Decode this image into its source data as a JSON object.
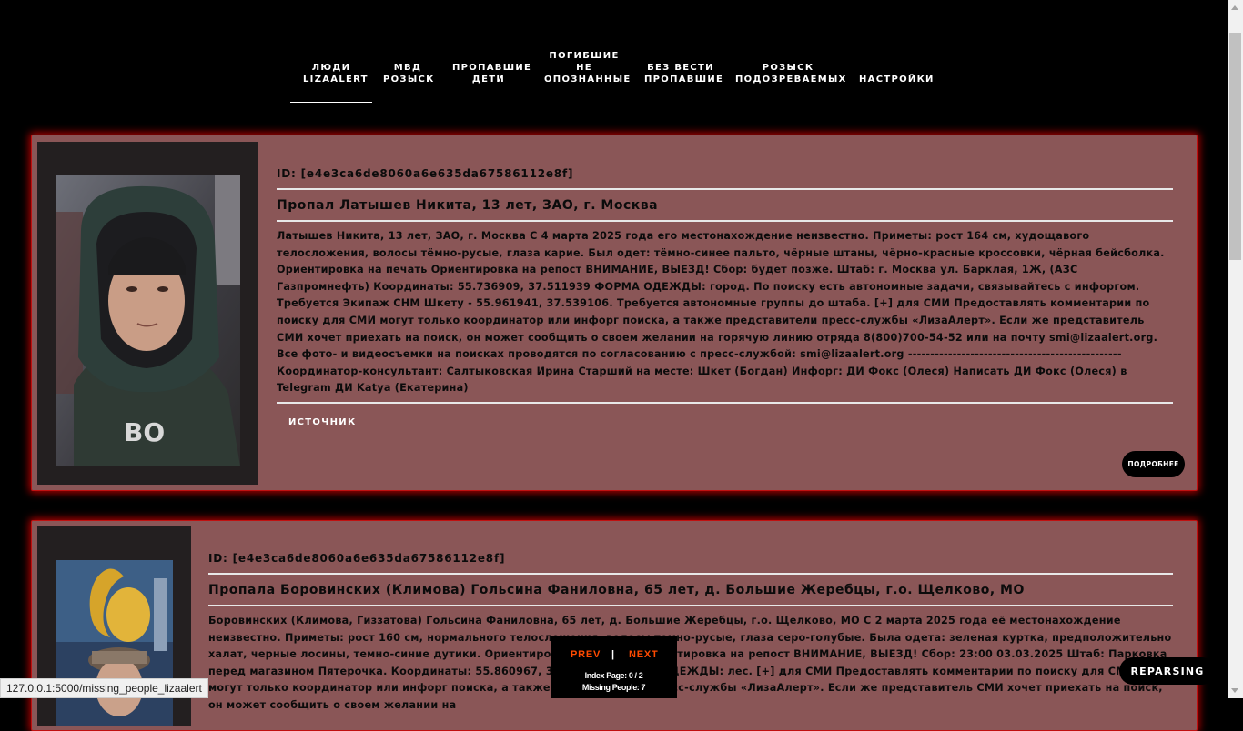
{
  "nav": {
    "items": [
      {
        "label": "ЛЮДИ\nLIZAALERT",
        "active": true
      },
      {
        "label": "МВД\nРОЗЫСК"
      },
      {
        "label": "ПРОПАВШИЕ\nДЕТИ"
      },
      {
        "label": "ПОГИБШИЕ\nНЕ\nОПОЗНАННЫЕ"
      },
      {
        "label": "БЕЗ ВЕСТИ\nПРОПАВШИЕ"
      },
      {
        "label": "РОЗЫСК\nПОДОЗРЕВАЕМЫХ"
      },
      {
        "label": "НАСТРОЙКИ"
      }
    ]
  },
  "cards": [
    {
      "id": "ID: [e4e3ca6de8060a6e635da67586112e8f]",
      "title": "Пропал Латышев Никита, 13 лет, ЗАО, г. Москва",
      "text": "Латышев Никита, 13 лет, ЗАО, г. Москва С 4 марта 2025 года его местонахождение неизвестно. Приметы: рост 164 см, худощавого телосложения, волосы тёмно-русые, глаза карие. Был одет: тёмно-синее пальто, чёрные штаны, чёрно-красные кроссовки, чёрная бейсболка. Ориентировка на печать Ориентировка на репост ВНИМАНИЕ, ВЫЕЗД! Сбор: будет позже. Штаб: г. Москва ул. Барклая, 1Ж, (АЗС Газпромнефть) Координаты: 55.736909, 37.511939 ФОРМА ОДЕЖДЫ: город. По поиску есть автономные задачи, связывайтесь с инфоргом. Требуется Экипаж СНМ Шкету - 55.961941, 37.539106. Требуется автономные группы до штаба. [+] для СМИ Предоставлять комментарии по поиску для СМИ могут только координатор или инфорг поиска, а также представители пресс-службы «ЛизаАлерт». Если же представитель СМИ хочет приехать на поиск, он может сообщить о своем желании на горячую линию отряда 8(800)700-54-52 или на почту smi@lizaalert.org. Все фото- и видеосъемки на поисках проводятся по согласованию с пресс-службой: smi@lizaalert.org ------------------------------------------------ Координатор-консультант: Салтыковская Ирина Старший на месте: Шкет (Богдан) Инфорг: ДИ Фокс (Олеся) Написать ДИ Фокс (Олеся) в Telegram ДИ Katya (Екатерина)",
      "source_label": "ИСТОЧНИК",
      "more_label": "ПОДРОБНЕЕ"
    },
    {
      "id": "ID: [e4e3ca6de8060a6e635da67586112e8f]",
      "title": "Пропала Боровинских (Климова) Гольсина Фаниловна, 65 лет, д. Большие Жеребцы, г.о. Щелково, МО",
      "text": "Боровинских (Климова, Гиззатова) Гольсина Фаниловна, 65 лет, д. Большие Жеребцы, г.о. Щелково, МО С 2 марта 2025 года её местонахождение неизвестно. Приметы: рост 160 см, нормального телосложения, волосы темно-русые, глаза серо-голубые. Была одета: зеленая куртка, предположительно халат, черные лосины, темно-синие дутики. Ориентировка на печать Ориентировка на репост ВНИМАНИЕ, ВЫЕЗД! Сбор: 23:00 03.03.2025 Штаб: Парковка перед магазином Пятерочка. Координаты: 55.860967, 38.046870 ФОРМА ОДЕЖДЫ: лес. [+] для СМИ Предоставлять комментарии по поиску для СМИ могут только координатор или инфорг поиска, а также представители пресс-службы «ЛизаАлерт». Если же представитель СМИ хочет приехать на поиск, он может сообщить о своем желании на"
    }
  ],
  "pager": {
    "prev_label": "PREV",
    "separator": "|",
    "next_label": "NEXT",
    "index_text": "Index Page: 0 / 2",
    "missing_text": "Missing People: 7"
  },
  "reparse_label": "REPARSING",
  "status_url": "127.0.0.1:5000/missing_people_lizaalert"
}
